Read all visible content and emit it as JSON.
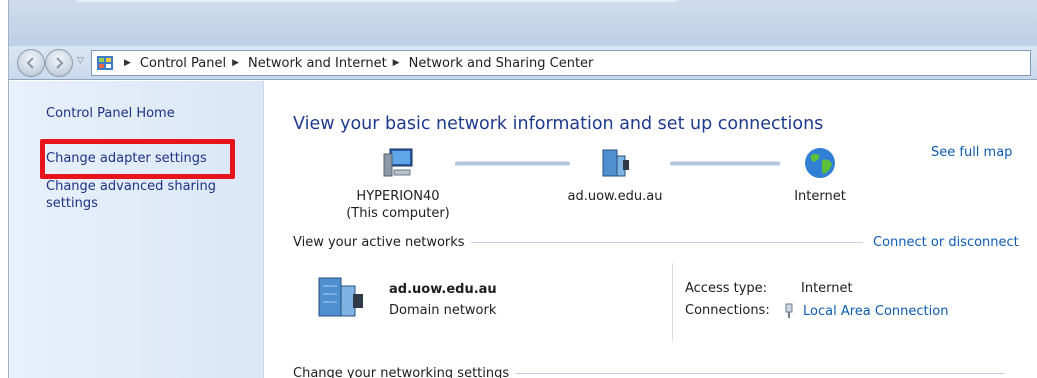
{
  "breadcrumb": {
    "items": [
      "Control Panel",
      "Network and Internet",
      "Network and Sharing Center"
    ]
  },
  "sidebar": {
    "home": "Control Panel Home",
    "adapter": "Change adapter settings",
    "advanced": "Change advanced sharing settings"
  },
  "main": {
    "title": "View your basic network information and set up connections",
    "see_full_map": "See full map",
    "nodes": {
      "computer_name": "HYPERION40",
      "computer_sub": "(This computer)",
      "domain": "ad.uow.edu.au",
      "internet": "Internet"
    },
    "active_networks": {
      "heading": "View your active networks",
      "connect_link": "Connect or disconnect",
      "network_name": "ad.uow.edu.au",
      "network_type": "Domain network",
      "access_type_label": "Access type:",
      "access_type_value": "Internet",
      "connections_label": "Connections:",
      "connections_value": "Local Area Connection"
    },
    "change_settings_heading": "Change your networking settings"
  },
  "colors": {
    "link": "#0d5bb5",
    "title": "#1e3a8f",
    "highlight": "#e8141b"
  },
  "icons": {
    "back": "back-arrow-icon",
    "forward": "forward-arrow-icon",
    "control_panel": "control-panel-icon",
    "computer": "computer-icon",
    "domain": "domain-server-icon",
    "internet": "globe-icon",
    "connection": "ethernet-plug-icon"
  }
}
